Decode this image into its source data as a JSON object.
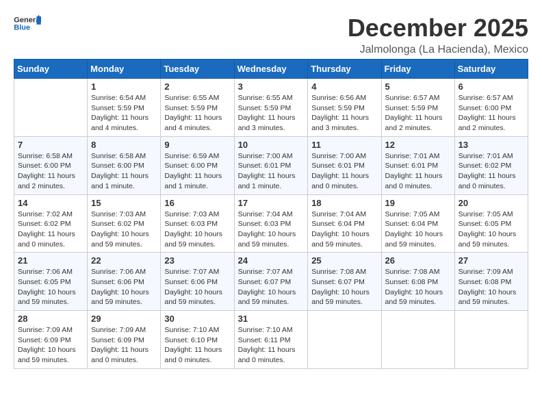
{
  "header": {
    "logo_general": "General",
    "logo_blue": "Blue",
    "month_title": "December 2025",
    "location": "Jalmolonga (La Hacienda), Mexico"
  },
  "calendar": {
    "days_of_week": [
      "Sunday",
      "Monday",
      "Tuesday",
      "Wednesday",
      "Thursday",
      "Friday",
      "Saturday"
    ],
    "weeks": [
      [
        {
          "day": "",
          "info": ""
        },
        {
          "day": "1",
          "info": "Sunrise: 6:54 AM\nSunset: 5:59 PM\nDaylight: 11 hours\nand 4 minutes."
        },
        {
          "day": "2",
          "info": "Sunrise: 6:55 AM\nSunset: 5:59 PM\nDaylight: 11 hours\nand 4 minutes."
        },
        {
          "day": "3",
          "info": "Sunrise: 6:55 AM\nSunset: 5:59 PM\nDaylight: 11 hours\nand 3 minutes."
        },
        {
          "day": "4",
          "info": "Sunrise: 6:56 AM\nSunset: 5:59 PM\nDaylight: 11 hours\nand 3 minutes."
        },
        {
          "day": "5",
          "info": "Sunrise: 6:57 AM\nSunset: 5:59 PM\nDaylight: 11 hours\nand 2 minutes."
        },
        {
          "day": "6",
          "info": "Sunrise: 6:57 AM\nSunset: 6:00 PM\nDaylight: 11 hours\nand 2 minutes."
        }
      ],
      [
        {
          "day": "7",
          "info": "Sunrise: 6:58 AM\nSunset: 6:00 PM\nDaylight: 11 hours\nand 2 minutes."
        },
        {
          "day": "8",
          "info": "Sunrise: 6:58 AM\nSunset: 6:00 PM\nDaylight: 11 hours\nand 1 minute."
        },
        {
          "day": "9",
          "info": "Sunrise: 6:59 AM\nSunset: 6:00 PM\nDaylight: 11 hours\nand 1 minute."
        },
        {
          "day": "10",
          "info": "Sunrise: 7:00 AM\nSunset: 6:01 PM\nDaylight: 11 hours\nand 1 minute."
        },
        {
          "day": "11",
          "info": "Sunrise: 7:00 AM\nSunset: 6:01 PM\nDaylight: 11 hours\nand 0 minutes."
        },
        {
          "day": "12",
          "info": "Sunrise: 7:01 AM\nSunset: 6:01 PM\nDaylight: 11 hours\nand 0 minutes."
        },
        {
          "day": "13",
          "info": "Sunrise: 7:01 AM\nSunset: 6:02 PM\nDaylight: 11 hours\nand 0 minutes."
        }
      ],
      [
        {
          "day": "14",
          "info": "Sunrise: 7:02 AM\nSunset: 6:02 PM\nDaylight: 11 hours\nand 0 minutes."
        },
        {
          "day": "15",
          "info": "Sunrise: 7:03 AM\nSunset: 6:02 PM\nDaylight: 10 hours\nand 59 minutes."
        },
        {
          "day": "16",
          "info": "Sunrise: 7:03 AM\nSunset: 6:03 PM\nDaylight: 10 hours\nand 59 minutes."
        },
        {
          "day": "17",
          "info": "Sunrise: 7:04 AM\nSunset: 6:03 PM\nDaylight: 10 hours\nand 59 minutes."
        },
        {
          "day": "18",
          "info": "Sunrise: 7:04 AM\nSunset: 6:04 PM\nDaylight: 10 hours\nand 59 minutes."
        },
        {
          "day": "19",
          "info": "Sunrise: 7:05 AM\nSunset: 6:04 PM\nDaylight: 10 hours\nand 59 minutes."
        },
        {
          "day": "20",
          "info": "Sunrise: 7:05 AM\nSunset: 6:05 PM\nDaylight: 10 hours\nand 59 minutes."
        }
      ],
      [
        {
          "day": "21",
          "info": "Sunrise: 7:06 AM\nSunset: 6:05 PM\nDaylight: 10 hours\nand 59 minutes."
        },
        {
          "day": "22",
          "info": "Sunrise: 7:06 AM\nSunset: 6:06 PM\nDaylight: 10 hours\nand 59 minutes."
        },
        {
          "day": "23",
          "info": "Sunrise: 7:07 AM\nSunset: 6:06 PM\nDaylight: 10 hours\nand 59 minutes."
        },
        {
          "day": "24",
          "info": "Sunrise: 7:07 AM\nSunset: 6:07 PM\nDaylight: 10 hours\nand 59 minutes."
        },
        {
          "day": "25",
          "info": "Sunrise: 7:08 AM\nSunset: 6:07 PM\nDaylight: 10 hours\nand 59 minutes."
        },
        {
          "day": "26",
          "info": "Sunrise: 7:08 AM\nSunset: 6:08 PM\nDaylight: 10 hours\nand 59 minutes."
        },
        {
          "day": "27",
          "info": "Sunrise: 7:09 AM\nSunset: 6:08 PM\nDaylight: 10 hours\nand 59 minutes."
        }
      ],
      [
        {
          "day": "28",
          "info": "Sunrise: 7:09 AM\nSunset: 6:09 PM\nDaylight: 10 hours\nand 59 minutes."
        },
        {
          "day": "29",
          "info": "Sunrise: 7:09 AM\nSunset: 6:09 PM\nDaylight: 11 hours\nand 0 minutes."
        },
        {
          "day": "30",
          "info": "Sunrise: 7:10 AM\nSunset: 6:10 PM\nDaylight: 11 hours\nand 0 minutes."
        },
        {
          "day": "31",
          "info": "Sunrise: 7:10 AM\nSunset: 6:11 PM\nDaylight: 11 hours\nand 0 minutes."
        },
        {
          "day": "",
          "info": ""
        },
        {
          "day": "",
          "info": ""
        },
        {
          "day": "",
          "info": ""
        }
      ]
    ]
  }
}
